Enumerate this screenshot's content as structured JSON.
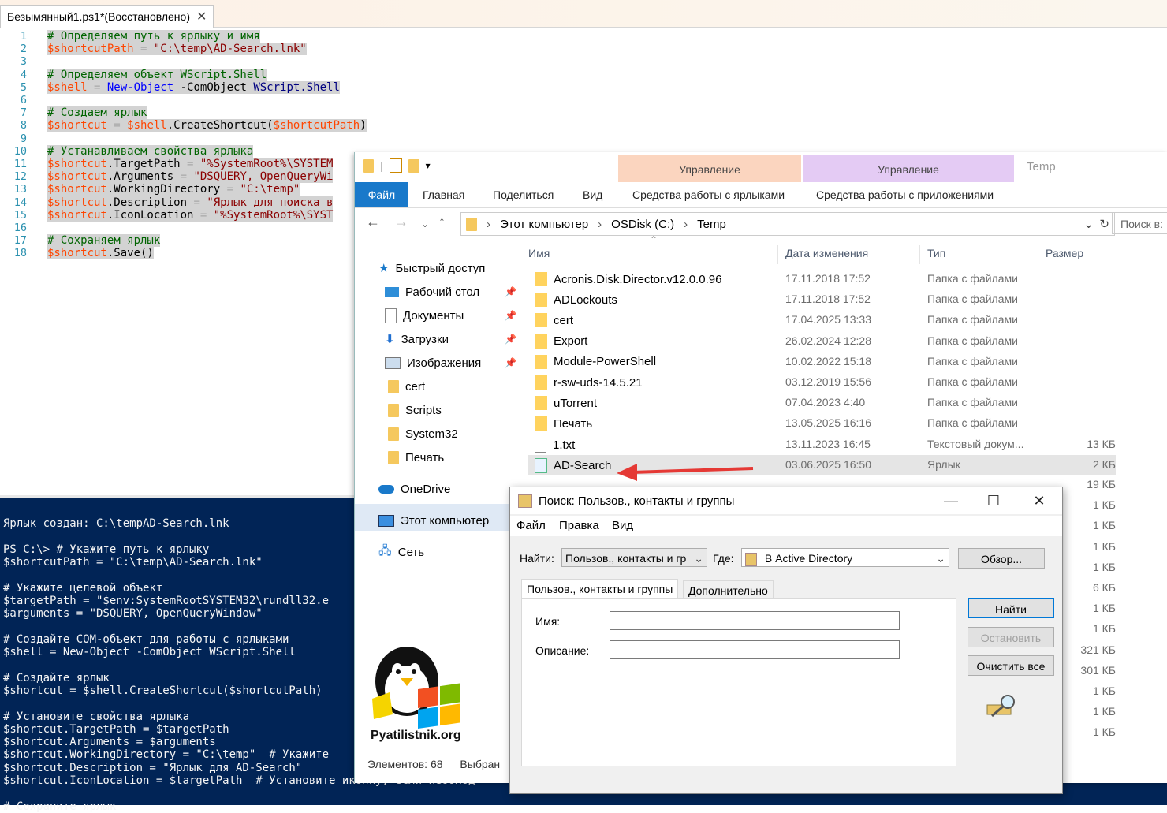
{
  "ise": {
    "tab_title": "Безымянный1.ps1*(Восстановлено)",
    "close_glyph": "✕",
    "lines": [
      {
        "n": "1",
        "parts": [
          [
            "cm",
            "# Определяем путь к ярлыку и имя"
          ]
        ]
      },
      {
        "n": "2",
        "parts": [
          [
            "var",
            "$shortcutPath"
          ],
          [
            "op",
            " = "
          ],
          [
            "str",
            "\"C:\\temp\\AD-Search.lnk\""
          ]
        ]
      },
      {
        "n": "3",
        "parts": []
      },
      {
        "n": "4",
        "parts": [
          [
            "cm",
            "# Определяем объект WScript.Shell"
          ]
        ]
      },
      {
        "n": "5",
        "parts": [
          [
            "var",
            "$shell"
          ],
          [
            "op",
            " = "
          ],
          [
            "cmd",
            "New-Object"
          ],
          [
            "mem",
            " -ComObject "
          ],
          [
            "par",
            "WScript.Shell"
          ]
        ]
      },
      {
        "n": "6",
        "parts": []
      },
      {
        "n": "7",
        "parts": [
          [
            "cm",
            "# Создаем ярлык"
          ]
        ]
      },
      {
        "n": "8",
        "parts": [
          [
            "var",
            "$shortcut"
          ],
          [
            "op",
            " = "
          ],
          [
            "var",
            "$shell"
          ],
          [
            "mem",
            ".CreateShortcut("
          ],
          [
            "var",
            "$shortcutPath"
          ],
          [
            "mem",
            ")"
          ]
        ]
      },
      {
        "n": "9",
        "parts": []
      },
      {
        "n": "10",
        "parts": [
          [
            "cm",
            "# Устанавливаем свойства ярлыка"
          ]
        ]
      },
      {
        "n": "11",
        "parts": [
          [
            "var",
            "$shortcut"
          ],
          [
            "mem",
            ".TargetPath"
          ],
          [
            "op",
            " = "
          ],
          [
            "str",
            "\"%SystemRoot%\\SYSTEM"
          ]
        ]
      },
      {
        "n": "12",
        "parts": [
          [
            "var",
            "$shortcut"
          ],
          [
            "mem",
            ".Arguments"
          ],
          [
            "op",
            " = "
          ],
          [
            "str",
            "\"DSQUERY, OpenQueryWi"
          ]
        ]
      },
      {
        "n": "13",
        "parts": [
          [
            "var",
            "$shortcut"
          ],
          [
            "mem",
            ".WorkingDirectory"
          ],
          [
            "op",
            " = "
          ],
          [
            "str",
            "\"C:\\temp\""
          ]
        ]
      },
      {
        "n": "14",
        "parts": [
          [
            "var",
            "$shortcut"
          ],
          [
            "mem",
            ".Description"
          ],
          [
            "op",
            " = "
          ],
          [
            "str",
            "\"Ярлык для поиска в"
          ]
        ]
      },
      {
        "n": "15",
        "parts": [
          [
            "var",
            "$shortcut"
          ],
          [
            "mem",
            ".IconLocation"
          ],
          [
            "op",
            " = "
          ],
          [
            "str",
            "\"%SystemRoot%\\SYST"
          ]
        ]
      },
      {
        "n": "16",
        "parts": []
      },
      {
        "n": "17",
        "parts": [
          [
            "cm",
            "# Сохраняем ярлык"
          ]
        ]
      },
      {
        "n": "18",
        "parts": [
          [
            "var",
            "$shortcut"
          ],
          [
            "mem",
            ".Save()"
          ]
        ]
      }
    ]
  },
  "console": {
    "lines": [
      "Ярлык создан: C:\\tempAD-Search.lnk",
      "",
      "PS C:\\> # Укажите путь к ярлыку",
      "$shortcutPath = \"C:\\temp\\AD-Search.lnk\"",
      "",
      "# Укажите целевой объект",
      "$targetPath = \"$env:SystemRootSYSTEM32\\rundll32.e",
      "$arguments = \"DSQUERY, OpenQueryWindow\"",
      "",
      "# Создайте COM-объект для работы с ярлыками",
      "$shell = New-Object -ComObject WScript.Shell",
      "",
      "# Создайте ярлык",
      "$shortcut = $shell.CreateShortcut($shortcutPath)",
      "",
      "# Установите свойства ярлыка",
      "$shortcut.TargetPath = $targetPath",
      "$shortcut.Arguments = $arguments",
      "$shortcut.WorkingDirectory = \"C:\\temp\"  # Укажите",
      "$shortcut.Description = \"Ярлык для AD-Search\"",
      "$shortcut.IconLocation = $targetPath  # Установите иконку, если необход",
      "",
      "# Сохраните ярлык"
    ]
  },
  "explorer": {
    "window_title": "Temp",
    "context_tab_1": "Управление",
    "context_tab_2": "Управление",
    "ribbon": {
      "file": "Файл",
      "home": "Главная",
      "share": "Поделиться",
      "view": "Вид",
      "shortcut_tools": "Средства работы с ярлыками",
      "app_tools": "Средства работы с приложениями"
    },
    "address": {
      "crumbs": [
        "Этот компьютер",
        "OSDisk (C:)",
        "Temp"
      ],
      "search_placeholder": "Поиск в:"
    },
    "nav": {
      "quick_access": "Быстрый доступ",
      "desktop": "Рабочий стол",
      "documents": "Документы",
      "downloads": "Загрузки",
      "pictures": "Изображения",
      "cert": "cert",
      "scripts": "Scripts",
      "system32": "System32",
      "print": "Печать",
      "onedrive": "OneDrive",
      "this_pc": "Этот компьютер",
      "network": "Сеть"
    },
    "columns": {
      "name": "Имя",
      "date": "Дата изменения",
      "type": "Тип",
      "size": "Размер"
    },
    "rows": [
      {
        "name": "Acronis.Disk.Director.v12.0.0.96",
        "date": "17.11.2018 17:52",
        "type": "Папка с файлами",
        "size": "",
        "icon": "folder"
      },
      {
        "name": "ADLockouts",
        "date": "17.11.2018 17:52",
        "type": "Папка с файлами",
        "size": "",
        "icon": "folder"
      },
      {
        "name": "cert",
        "date": "17.04.2025 13:33",
        "type": "Папка с файлами",
        "size": "",
        "icon": "folder"
      },
      {
        "name": "Export",
        "date": "26.02.2024 12:28",
        "type": "Папка с файлами",
        "size": "",
        "icon": "folder"
      },
      {
        "name": "Module-PowerShell",
        "date": "10.02.2022 15:18",
        "type": "Папка с файлами",
        "size": "",
        "icon": "folder"
      },
      {
        "name": "r-sw-uds-14.5.21",
        "date": "03.12.2019 15:56",
        "type": "Папка с файлами",
        "size": "",
        "icon": "folder"
      },
      {
        "name": "uTorrent",
        "date": "07.04.2023 4:40",
        "type": "Папка с файлами",
        "size": "",
        "icon": "folder"
      },
      {
        "name": "Печать",
        "date": "13.05.2025 16:16",
        "type": "Папка с файлами",
        "size": "",
        "icon": "folder"
      },
      {
        "name": "1.txt",
        "date": "13.11.2023 16:45",
        "type": "Текстовый докум...",
        "size": "13 КБ",
        "icon": "text"
      },
      {
        "name": "AD-Search",
        "date": "03.06.2025 16:50",
        "type": "Ярлык",
        "size": "2 КБ",
        "icon": "shortcut"
      }
    ],
    "hidden_sizes": [
      "19 КБ",
      "1 КБ",
      "1 КБ",
      "1 КБ",
      "1 КБ",
      "6 КБ",
      "1 КБ",
      "1 КБ",
      "321 КБ",
      "301 КБ",
      "1 КБ",
      "1 КБ",
      "1 КБ"
    ],
    "status_count": "Элементов: 68",
    "status_selected": "Выбран"
  },
  "dialog": {
    "title": "Поиск: Пользов., контакты и группы",
    "menu": [
      "Файл",
      "Правка",
      "Вид"
    ],
    "find_label": "Найти:",
    "find_value": "Пользов., контакты и гр",
    "where_label": "Где:",
    "where_value": "В Active Directory",
    "browse": "Обзор...",
    "tab1": "Пользов., контакты и группы",
    "tab2": "Дополнительно",
    "name_label": "Имя:",
    "desc_label": "Описание:",
    "name_value": "",
    "desc_value": "",
    "btn_find": "Найти",
    "btn_stop": "Остановить",
    "btn_clear": "Очистить все"
  },
  "watermark": {
    "text": "Pyatilistnik.org"
  },
  "colors": {
    "console_bg": "#012456",
    "accent": "#1979ca",
    "arrow": "#e53935"
  }
}
